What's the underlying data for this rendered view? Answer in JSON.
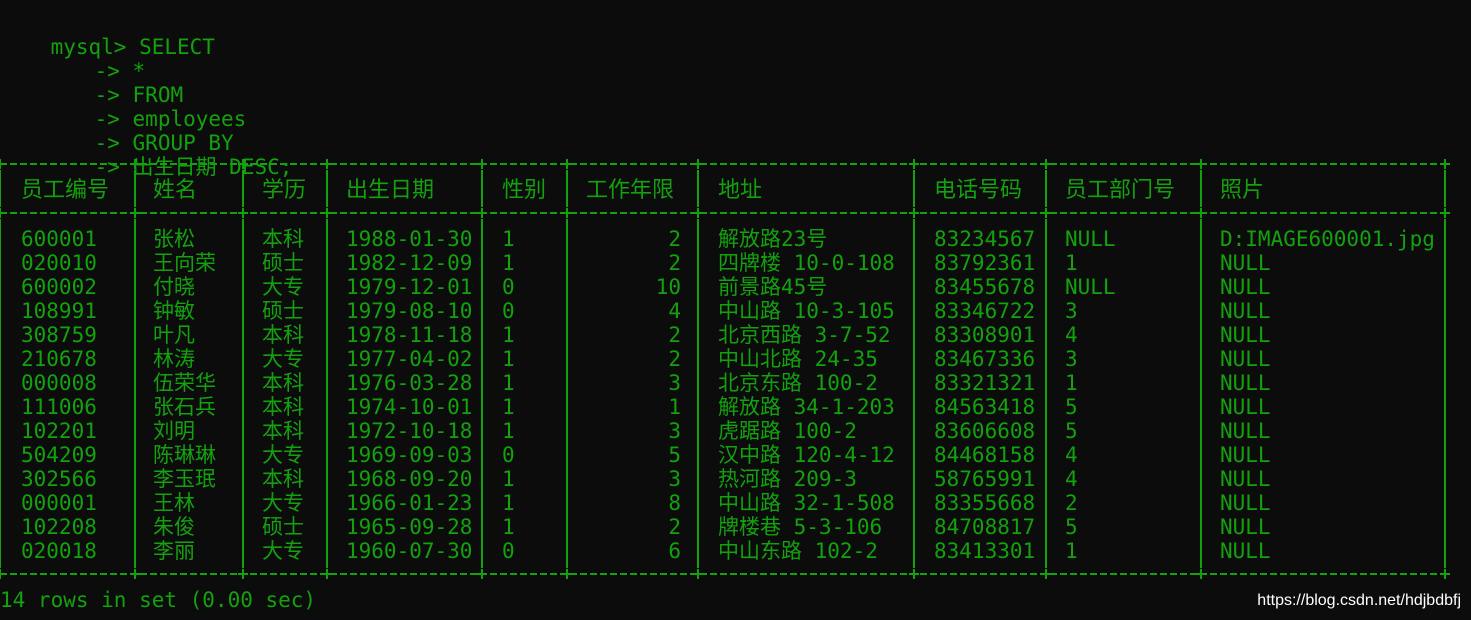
{
  "terminal": {
    "prompt": "mysql>",
    "continuation": "->",
    "query_lines": [
      "SELECT",
      "*",
      "FROM",
      "employees",
      "GROUP BY",
      "出生日期 DESC;"
    ],
    "columns": [
      "员工编号",
      "姓名",
      "学历",
      "出生日期",
      "性别",
      "工作年限",
      "地址",
      "电话号码",
      "员工部门号",
      "照片"
    ],
    "rows": [
      [
        "600001",
        "张松",
        "本科",
        "1988-01-30",
        "1",
        "2",
        "解放路23号",
        "83234567",
        "NULL",
        "D:IMAGE600001.jpg"
      ],
      [
        "020010",
        "王向荣",
        "硕士",
        "1982-12-09",
        "1",
        "2",
        "四牌楼 10-0-108",
        "83792361",
        "1",
        "NULL"
      ],
      [
        "600002",
        "付晓",
        "大专",
        "1979-12-01",
        "0",
        "10",
        "前景路45号",
        "83455678",
        "NULL",
        "NULL"
      ],
      [
        "108991",
        "钟敏",
        "硕士",
        "1979-08-10",
        "0",
        "4",
        "中山路 10-3-105",
        "83346722",
        "3",
        "NULL"
      ],
      [
        "308759",
        "叶凡",
        "本科",
        "1978-11-18",
        "1",
        "2",
        "北京西路 3-7-52",
        "83308901",
        "4",
        "NULL"
      ],
      [
        "210678",
        "林涛",
        "大专",
        "1977-04-02",
        "1",
        "2",
        "中山北路 24-35",
        "83467336",
        "3",
        "NULL"
      ],
      [
        "000008",
        "伍荣华",
        "本科",
        "1976-03-28",
        "1",
        "3",
        "北京东路 100-2",
        "83321321",
        "1",
        "NULL"
      ],
      [
        "111006",
        "张石兵",
        "本科",
        "1974-10-01",
        "1",
        "1",
        "解放路 34-1-203",
        "84563418",
        "5",
        "NULL"
      ],
      [
        "102201",
        "刘明",
        "本科",
        "1972-10-18",
        "1",
        "3",
        "虎踞路 100-2",
        "83606608",
        "5",
        "NULL"
      ],
      [
        "504209",
        "陈琳琳",
        "大专",
        "1969-09-03",
        "0",
        "5",
        "汉中路 120-4-12",
        "84468158",
        "4",
        "NULL"
      ],
      [
        "302566",
        "李玉珉",
        "本科",
        "1968-09-20",
        "1",
        "3",
        "热河路 209-3",
        "58765991",
        "4",
        "NULL"
      ],
      [
        "000001",
        "王林",
        "大专",
        "1966-01-23",
        "1",
        "8",
        "中山路 32-1-508",
        "83355668",
        "2",
        "NULL"
      ],
      [
        "102208",
        "朱俊",
        "硕士",
        "1965-09-28",
        "1",
        "2",
        "牌楼巷 5-3-106",
        "84708817",
        "5",
        "NULL"
      ],
      [
        "020018",
        "李丽",
        "大专",
        "1960-07-30",
        "0",
        "6",
        "中山东路 102-2",
        "83413301",
        "1",
        "NULL"
      ]
    ],
    "result_summary": "14 rows in set (0.00 sec)",
    "text_color": "#13a10e",
    "background_color": "#0c0c0c"
  },
  "watermark": "https://blog.csdn.net/hdjbdbfj"
}
